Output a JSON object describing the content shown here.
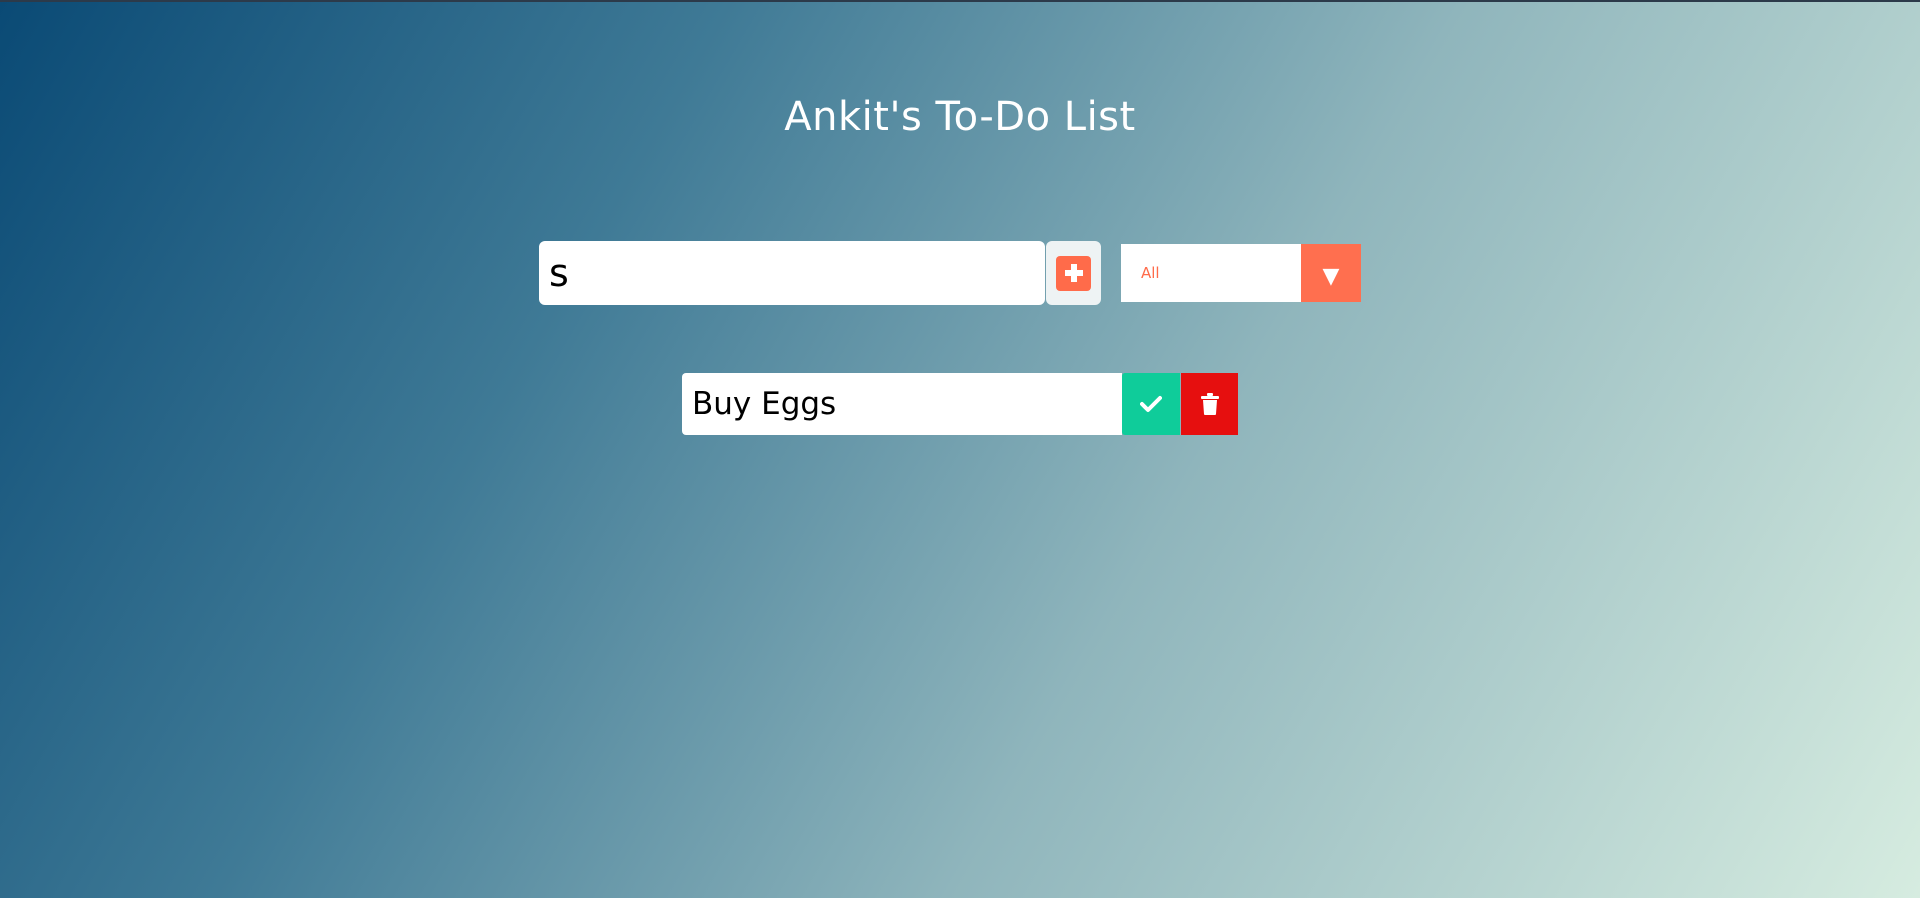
{
  "header": {
    "title": "Ankit's To-Do List"
  },
  "form": {
    "input_value": "s",
    "add_icon": "plus-square-icon",
    "filter": {
      "selected": "All",
      "arrow": "▼"
    }
  },
  "todos": [
    {
      "text": "Buy Eggs",
      "complete_icon": "check-icon",
      "delete_icon": "trash-icon"
    }
  ],
  "colors": {
    "accent": "#ff6b4a",
    "complete": "#0fcc9a",
    "delete": "#e60f0f"
  }
}
